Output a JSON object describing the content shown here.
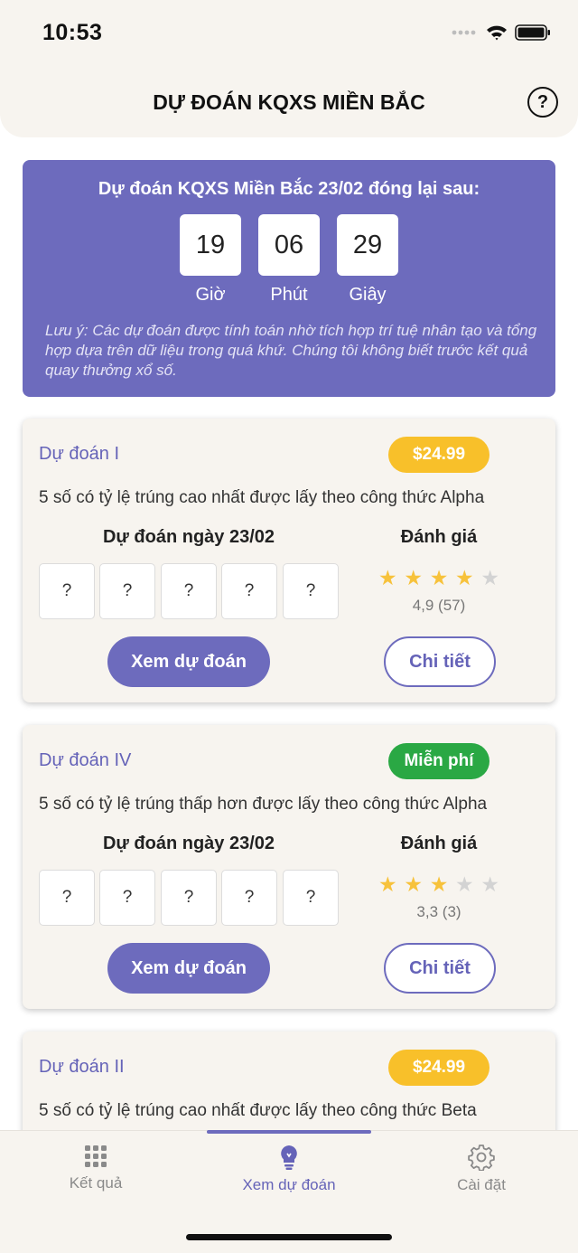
{
  "status": {
    "time": "10:53"
  },
  "header": {
    "title": "DỰ ĐOÁN KQXS MIỀN BẮC",
    "help_icon": "question-circle-icon",
    "help_label": "?"
  },
  "countdown": {
    "title": "Dự đoán KQXS Miền Bắc 23/02 đóng lại sau:",
    "hours": "19",
    "minutes": "06",
    "seconds": "29",
    "hours_label": "Giờ",
    "minutes_label": "Phút",
    "seconds_label": "Giây",
    "note": "Lưu ý: Các dự đoán được tính toán nhờ tích hợp trí tuệ nhân tạo và tổng hợp dựa trên dữ liệu trong quá khứ. Chúng tôi không biết trước kết quả quay thưởng xổ số."
  },
  "cards": [
    {
      "title": "Dự đoán I",
      "price": "$24.99",
      "price_color": "#f8c02a",
      "description": "5 số có tỷ lệ trúng cao nhất được lấy theo công thức Alpha",
      "predict_label": "Dự đoán ngày 23/02",
      "rating_label": "Đánh giá",
      "numbers": [
        "?",
        "?",
        "?",
        "?",
        "?"
      ],
      "stars": 4,
      "rating_text": "4,9 (57)",
      "view_button": "Xem dự đoán",
      "detail_button": "Chi tiết"
    },
    {
      "title": "Dự đoán IV",
      "price": "Miễn phí",
      "price_color": "#2aa844",
      "description": "5 số có tỷ lệ trúng thấp hơn được lấy theo công thức Alpha",
      "predict_label": "Dự đoán ngày 23/02",
      "rating_label": "Đánh giá",
      "numbers": [
        "?",
        "?",
        "?",
        "?",
        "?"
      ],
      "stars": 3,
      "rating_text": "3,3 (3)",
      "view_button": "Xem dự đoán",
      "detail_button": "Chi tiết"
    },
    {
      "title": "Dự đoán II",
      "price": "$24.99",
      "price_color": "#f8c02a",
      "description": "5 số có tỷ lệ trúng cao nhất được lấy theo công thức Beta"
    }
  ],
  "tabs": [
    {
      "label": "Kết quả",
      "icon": "grid-icon"
    },
    {
      "label": "Xem dự đoán",
      "icon": "lightbulb-icon",
      "active": true
    },
    {
      "label": "Cài đặt",
      "icon": "gear-icon"
    }
  ],
  "colors": {
    "accent": "#6d6bbd",
    "background": "#f7f4ef",
    "star": "#f7c23b",
    "paid_badge": "#f8c02a",
    "free_badge": "#2aa844"
  }
}
